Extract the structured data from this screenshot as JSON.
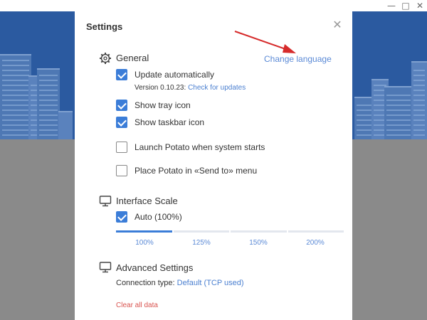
{
  "window": {
    "minimize_glyph": "—",
    "maximize_glyph": "□",
    "close_glyph": "✕"
  },
  "dialog": {
    "title": "Settings",
    "close_glyph": "✕"
  },
  "general": {
    "title": "General",
    "icon": "gear-icon",
    "change_language": "Change language",
    "update_automatically": "Update automatically",
    "version_text": "Version 0.10.23:",
    "check_updates": "Check for updates",
    "show_tray_icon": "Show tray icon",
    "show_taskbar_icon": "Show taskbar icon",
    "launch_on_start": "Launch Potato when system starts",
    "send_to_menu": "Place Potato in «Send to» menu",
    "checked": {
      "update_automatically": true,
      "show_tray_icon": true,
      "show_taskbar_icon": true,
      "launch_on_start": false,
      "send_to_menu": false
    }
  },
  "interface_scale": {
    "title": "Interface Scale",
    "icon": "monitor-icon",
    "auto_label": "Auto (100%)",
    "auto_checked": true,
    "options": [
      "100%",
      "125%",
      "150%",
      "200%"
    ],
    "selected": "100%"
  },
  "advanced": {
    "title": "Advanced Settings",
    "icon": "monitor-icon",
    "connection_label": "Connection type:",
    "connection_value": "Default (TCP used)",
    "clear_all": "Clear all data"
  },
  "colors": {
    "accent": "#3b7dd8",
    "link": "#4a7fd0",
    "danger": "#d9534f",
    "sky": "#2b5aa0",
    "annotation_arrow": "#d62b2b"
  }
}
